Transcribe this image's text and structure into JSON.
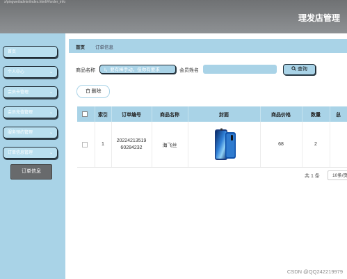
{
  "header": {
    "path_text": "x/pingwei/admin/index.html/#/order_info",
    "app_title": "理发店管理"
  },
  "sidebar": {
    "items": [
      {
        "label": "首页",
        "has_chevron": false
      },
      {
        "label": "个人中心",
        "has_chevron": true
      },
      {
        "label": "会员卡管理",
        "has_chevron": true
      },
      {
        "label": "会员充值管理",
        "has_chevron": true
      },
      {
        "label": "服务预约管理",
        "has_chevron": true
      },
      {
        "label": "订单信息管理",
        "has_chevron": true
      }
    ],
    "active_sub": "订单信息",
    "chevron": "⌄"
  },
  "breadcrumb": {
    "home": "首页",
    "current": "订单信息"
  },
  "search": {
    "product_label": "商品名称",
    "product_value": "I。要有棒手动，但你有要求",
    "member_label": "会员姓名",
    "member_value": "",
    "search_button": "查询",
    "search_icon": "search-icon"
  },
  "actions": {
    "delete_button": "删除",
    "delete_icon": "trash-icon"
  },
  "table": {
    "columns": [
      "",
      "索引",
      "订单编号",
      "商品名称",
      "封面",
      "商品价格",
      "数量",
      "总"
    ],
    "rows": [
      {
        "index": "1",
        "order_no_line1": "20224213519",
        "order_no_line2": "60284232",
        "product": "海飞丝",
        "cover": "phone-image",
        "price": "68",
        "qty": "2"
      }
    ]
  },
  "pagination": {
    "total": "共 1 条",
    "page_size": "10条/页"
  },
  "watermark": "CSDN @QQ242219979",
  "colors": {
    "accent": "#a9d3e7",
    "header": "#7f8285",
    "sub_item": "#686a6c"
  }
}
